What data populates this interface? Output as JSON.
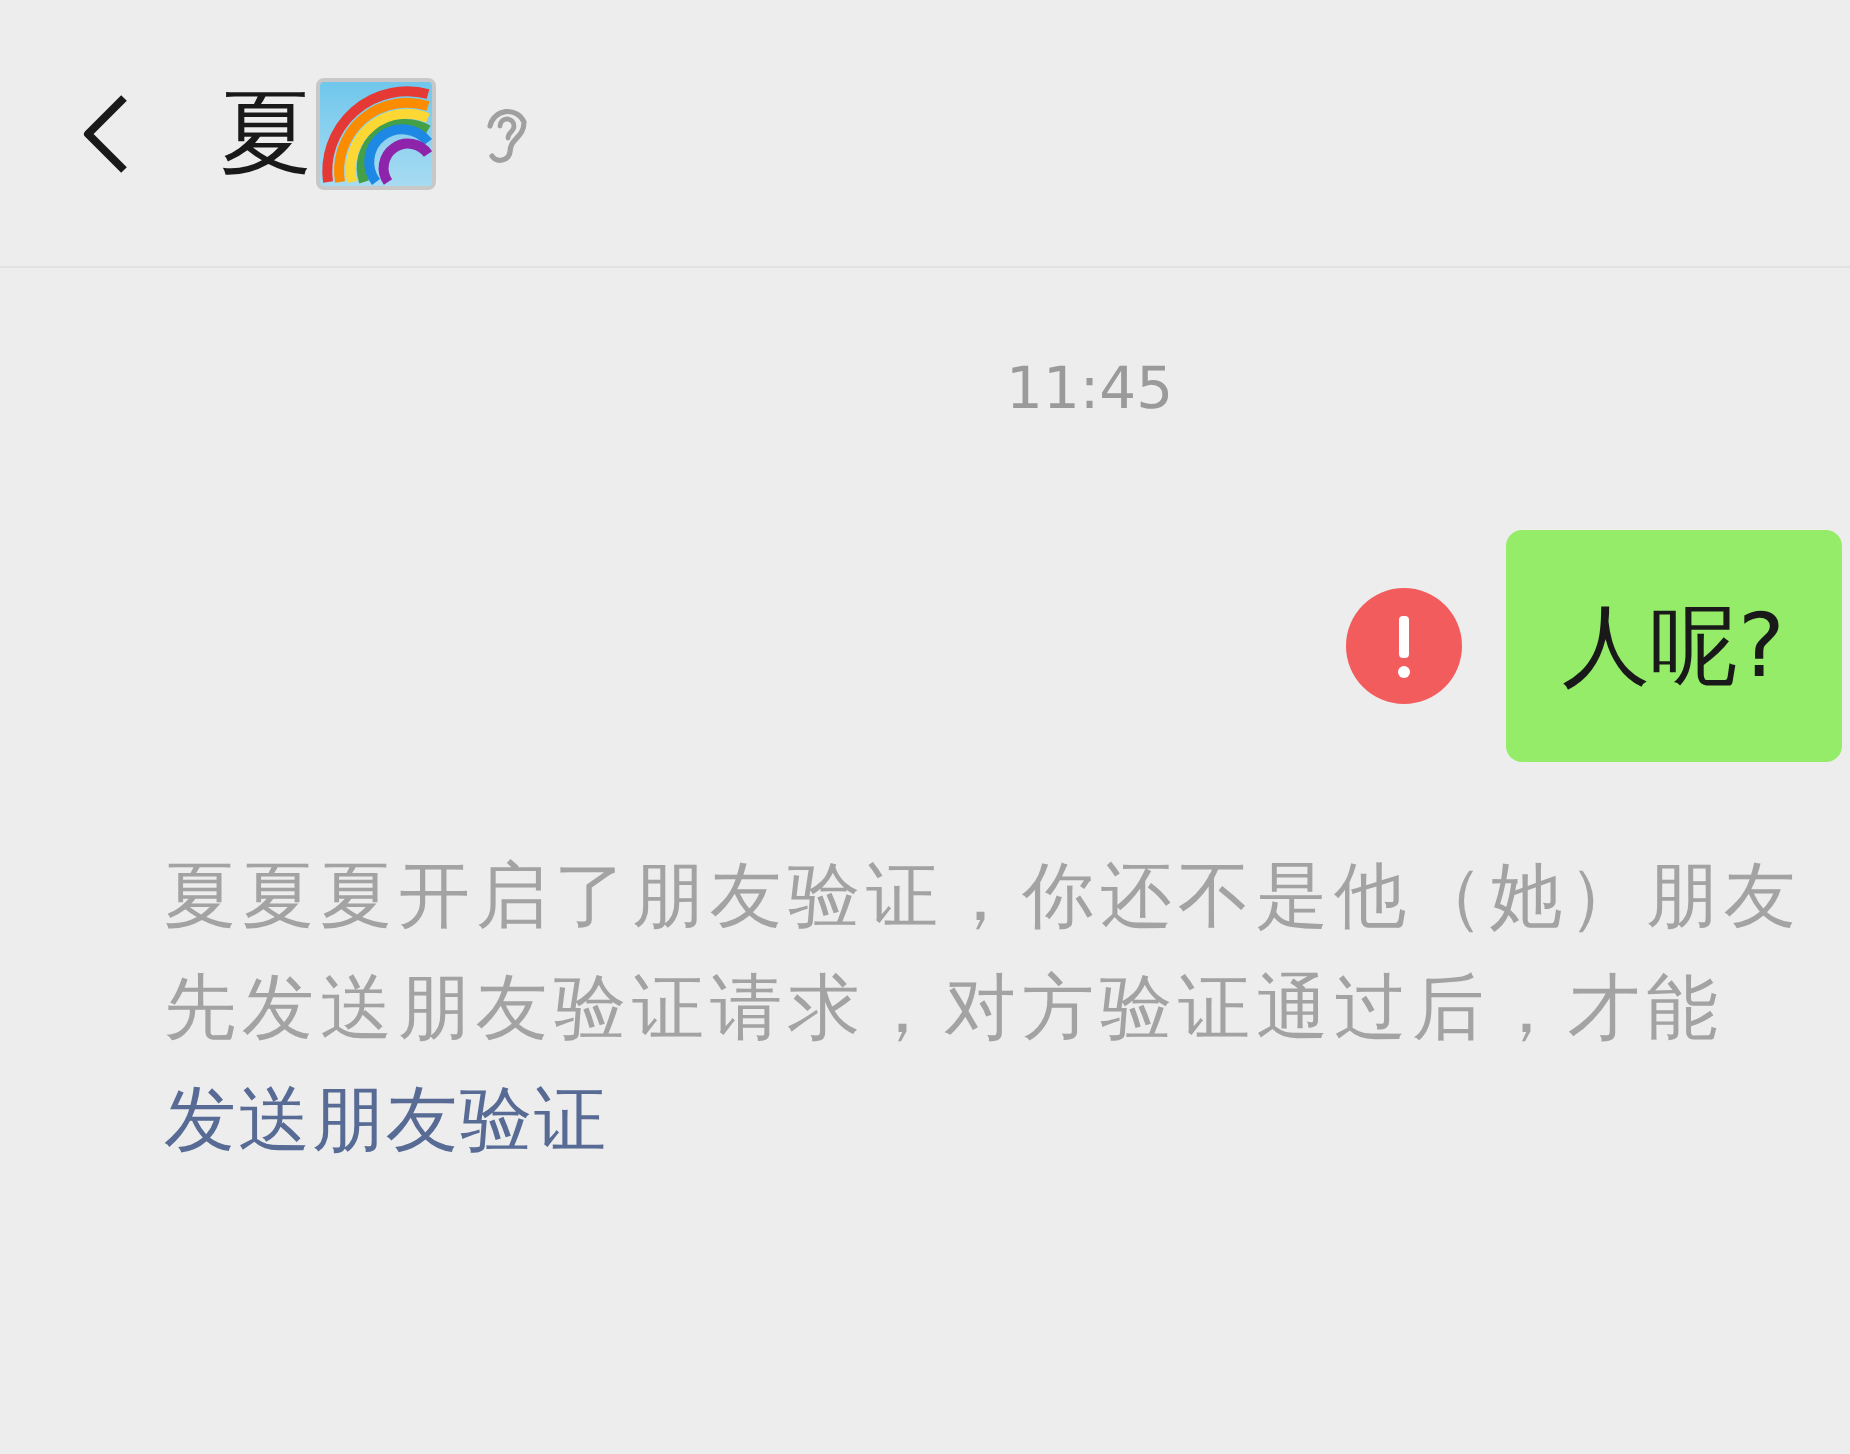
{
  "header": {
    "title": "夏"
  },
  "messages": [
    {
      "kind": "time",
      "text": "11:45"
    },
    {
      "kind": "outgoing",
      "text": "人呢?",
      "failed": true
    },
    {
      "kind": "system",
      "lines": [
        "夏夏夏开启了朋友验证，你还不是他（她）朋友",
        "先发送朋友验证请求，对方验证通过后，才能"
      ],
      "link": "发送朋友验证"
    }
  ]
}
